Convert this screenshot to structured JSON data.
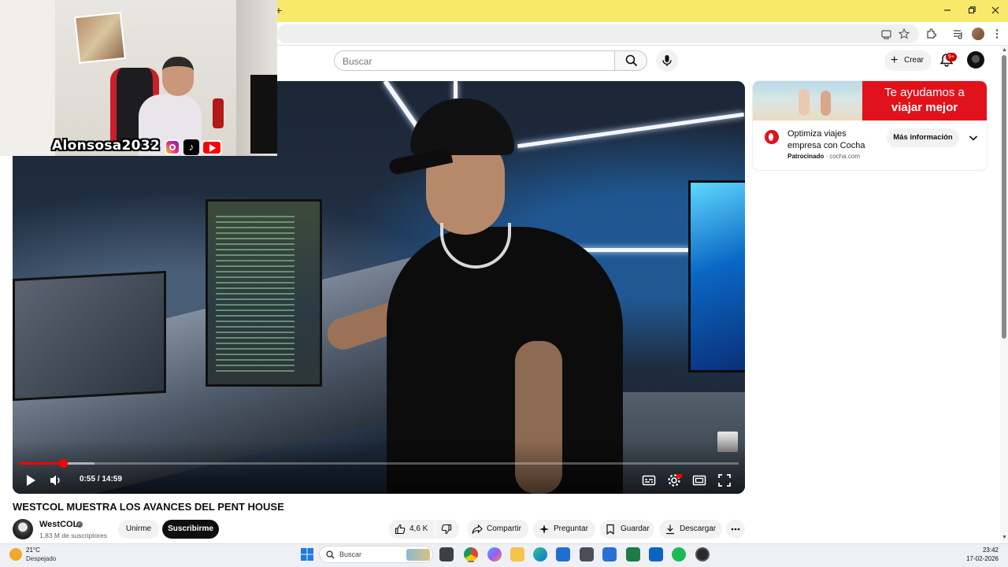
{
  "browser": {
    "new_tab_symbol": "+",
    "titlebar_color": "#f9e96b",
    "window_controls": [
      "minimize",
      "restore",
      "close"
    ],
    "toolbar_icons": [
      "cast-icon",
      "star-icon",
      "extensions-icon",
      "media-icon",
      "profile-avatar",
      "menu-icon"
    ]
  },
  "header": {
    "search": {
      "placeholder": "Buscar",
      "value": ""
    },
    "create_label": "Crear",
    "notifications_badge": "9+"
  },
  "cam_overlay": {
    "handle": "Alonsosa2032",
    "social_icons": [
      "instagram-icon",
      "tiktok-icon",
      "youtube-icon"
    ]
  },
  "player": {
    "current_time": "0:55",
    "duration": "14:59",
    "time_display": "0:55 / 14:59",
    "progress_fraction": 0.061,
    "buffered_fraction": 0.105,
    "accent_color": "#ff0000",
    "controls": [
      "play-icon",
      "volume-icon",
      "subtitles-icon",
      "settings-icon",
      "theater-icon",
      "fullscreen-icon"
    ]
  },
  "video": {
    "title": "WESTCOL MUESTRA LOS AVANCES DEL PENT HOUSE",
    "channel_name": "WestCOL",
    "subscribers": "1,83 M de suscriptores",
    "join_label": "Unirme",
    "subscribe_label": "Suscribirme",
    "likes": "4,6 K",
    "share_label": "Compartir",
    "ask_label": "Preguntar",
    "save_label": "Guardar",
    "download_label": "Descargar"
  },
  "ad": {
    "banner_line1": "Te ayudamos a",
    "banner_line2": "viajar mejor",
    "headline": "Optimiza viajes empresa con Cocha",
    "sponsored_label": "Patrocinado",
    "separator": " · ",
    "domain": "cocha.com",
    "cta_label": "Más información",
    "brand_color": "#e1121b"
  },
  "taskbar": {
    "weather_temp": "21°C",
    "weather_desc": "Despejado",
    "search_placeholder": "Buscar",
    "time": "23:42",
    "date": "17-02-2026",
    "apps": [
      "windows-start-icon",
      "file-explorer-icon",
      "chrome-icon",
      "copilot-icon",
      "folder-icon",
      "edge-icon",
      "store-icon",
      "game-icon",
      "visual-studio-icon",
      "excel-icon",
      "outlook-icon",
      "spotify-icon",
      "obs-icon"
    ]
  }
}
